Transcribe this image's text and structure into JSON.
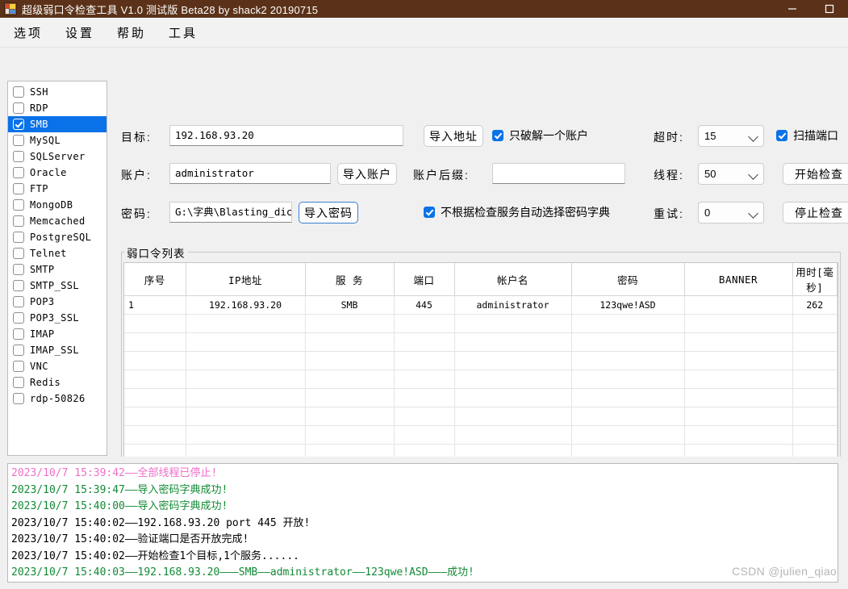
{
  "window": {
    "title": "超级弱口令检查工具 V1.0 测试版 Beta28 by shack2 20190715",
    "icon": "app-grid-icon",
    "buttons": {
      "minimize": "minimize-icon",
      "maximize": "maximize-icon"
    }
  },
  "menu": {
    "items": [
      "选项",
      "设置",
      "帮助",
      "工具"
    ]
  },
  "protocols": [
    {
      "label": "SSH",
      "checked": false,
      "selected": false
    },
    {
      "label": "RDP",
      "checked": false,
      "selected": false
    },
    {
      "label": "SMB",
      "checked": true,
      "selected": true
    },
    {
      "label": "MySQL",
      "checked": false,
      "selected": false
    },
    {
      "label": "SQLServer",
      "checked": false,
      "selected": false
    },
    {
      "label": "Oracle",
      "checked": false,
      "selected": false
    },
    {
      "label": "FTP",
      "checked": false,
      "selected": false
    },
    {
      "label": "MongoDB",
      "checked": false,
      "selected": false
    },
    {
      "label": "Memcached",
      "checked": false,
      "selected": false
    },
    {
      "label": "PostgreSQL",
      "checked": false,
      "selected": false
    },
    {
      "label": "Telnet",
      "checked": false,
      "selected": false
    },
    {
      "label": "SMTP",
      "checked": false,
      "selected": false
    },
    {
      "label": "SMTP_SSL",
      "checked": false,
      "selected": false
    },
    {
      "label": "POP3",
      "checked": false,
      "selected": false
    },
    {
      "label": "POP3_SSL",
      "checked": false,
      "selected": false
    },
    {
      "label": "IMAP",
      "checked": false,
      "selected": false
    },
    {
      "label": "IMAP_SSL",
      "checked": false,
      "selected": false
    },
    {
      "label": "VNC",
      "checked": false,
      "selected": false
    },
    {
      "label": "Redis",
      "checked": false,
      "selected": false
    },
    {
      "label": "rdp-50826",
      "checked": false,
      "selected": false
    }
  ],
  "form": {
    "target_label": "目标:",
    "target_value": "192.168.93.20",
    "import_address_button": "导入地址",
    "only_one_account_label": "只破解一个账户",
    "only_one_account_checked": true,
    "timeout_label": "超时:",
    "timeout_value": "15",
    "scan_port_label": "扫描端口",
    "scan_port_checked": true,
    "account_label": "账户:",
    "account_value": "administrator",
    "import_account_button": "导入账户",
    "account_suffix_label": "账户后缀:",
    "account_suffix_value": "",
    "thread_label": "线程:",
    "thread_value": "50",
    "start_button": "开始检查",
    "password_label": "密码:",
    "password_value": "G:\\字典\\Blasting_dictionar",
    "import_password_button": "导入密码",
    "auto_dict_label": "不根据检查服务自动选择密码字典",
    "auto_dict_checked": true,
    "retry_label": "重试:",
    "retry_value": "0",
    "stop_button": "停止检查"
  },
  "results": {
    "legend": "弱口令列表",
    "columns": [
      "序号",
      "IP地址",
      "服 务",
      "端口",
      "帐户名",
      "密码",
      "BANNER",
      "用时[毫秒]"
    ],
    "rows": [
      [
        "1",
        "192.168.93.20",
        "SMB",
        "445",
        "administrator",
        "123qwe!ASD",
        "",
        "262"
      ]
    ]
  },
  "log": {
    "lines": [
      {
        "text": "2023/10/7 15:39:42——全部线程已停止!",
        "color": "pink"
      },
      {
        "text": "2023/10/7 15:39:47——导入密码字典成功!",
        "color": "green"
      },
      {
        "text": "2023/10/7 15:40:00——导入密码字典成功!",
        "color": "green"
      },
      {
        "text": "2023/10/7 15:40:02——192.168.93.20 port 445 开放!",
        "color": "black"
      },
      {
        "text": "2023/10/7 15:40:02——验证端口是否开放完成!",
        "color": "black"
      },
      {
        "text": "2023/10/7 15:40:02——开始检查1个目标,1个服务......",
        "color": "black"
      },
      {
        "text": "2023/10/7 15:40:03——192.168.93.20———SMB——administrator——123qwe!ASD———成功!",
        "color": "green"
      }
    ]
  },
  "watermark": "CSDN @julien_qiao",
  "colors": {
    "titlebar": "#5b3219",
    "accent": "#0a72e8",
    "log_pink": "#f06ec8",
    "log_green": "#118a35"
  }
}
